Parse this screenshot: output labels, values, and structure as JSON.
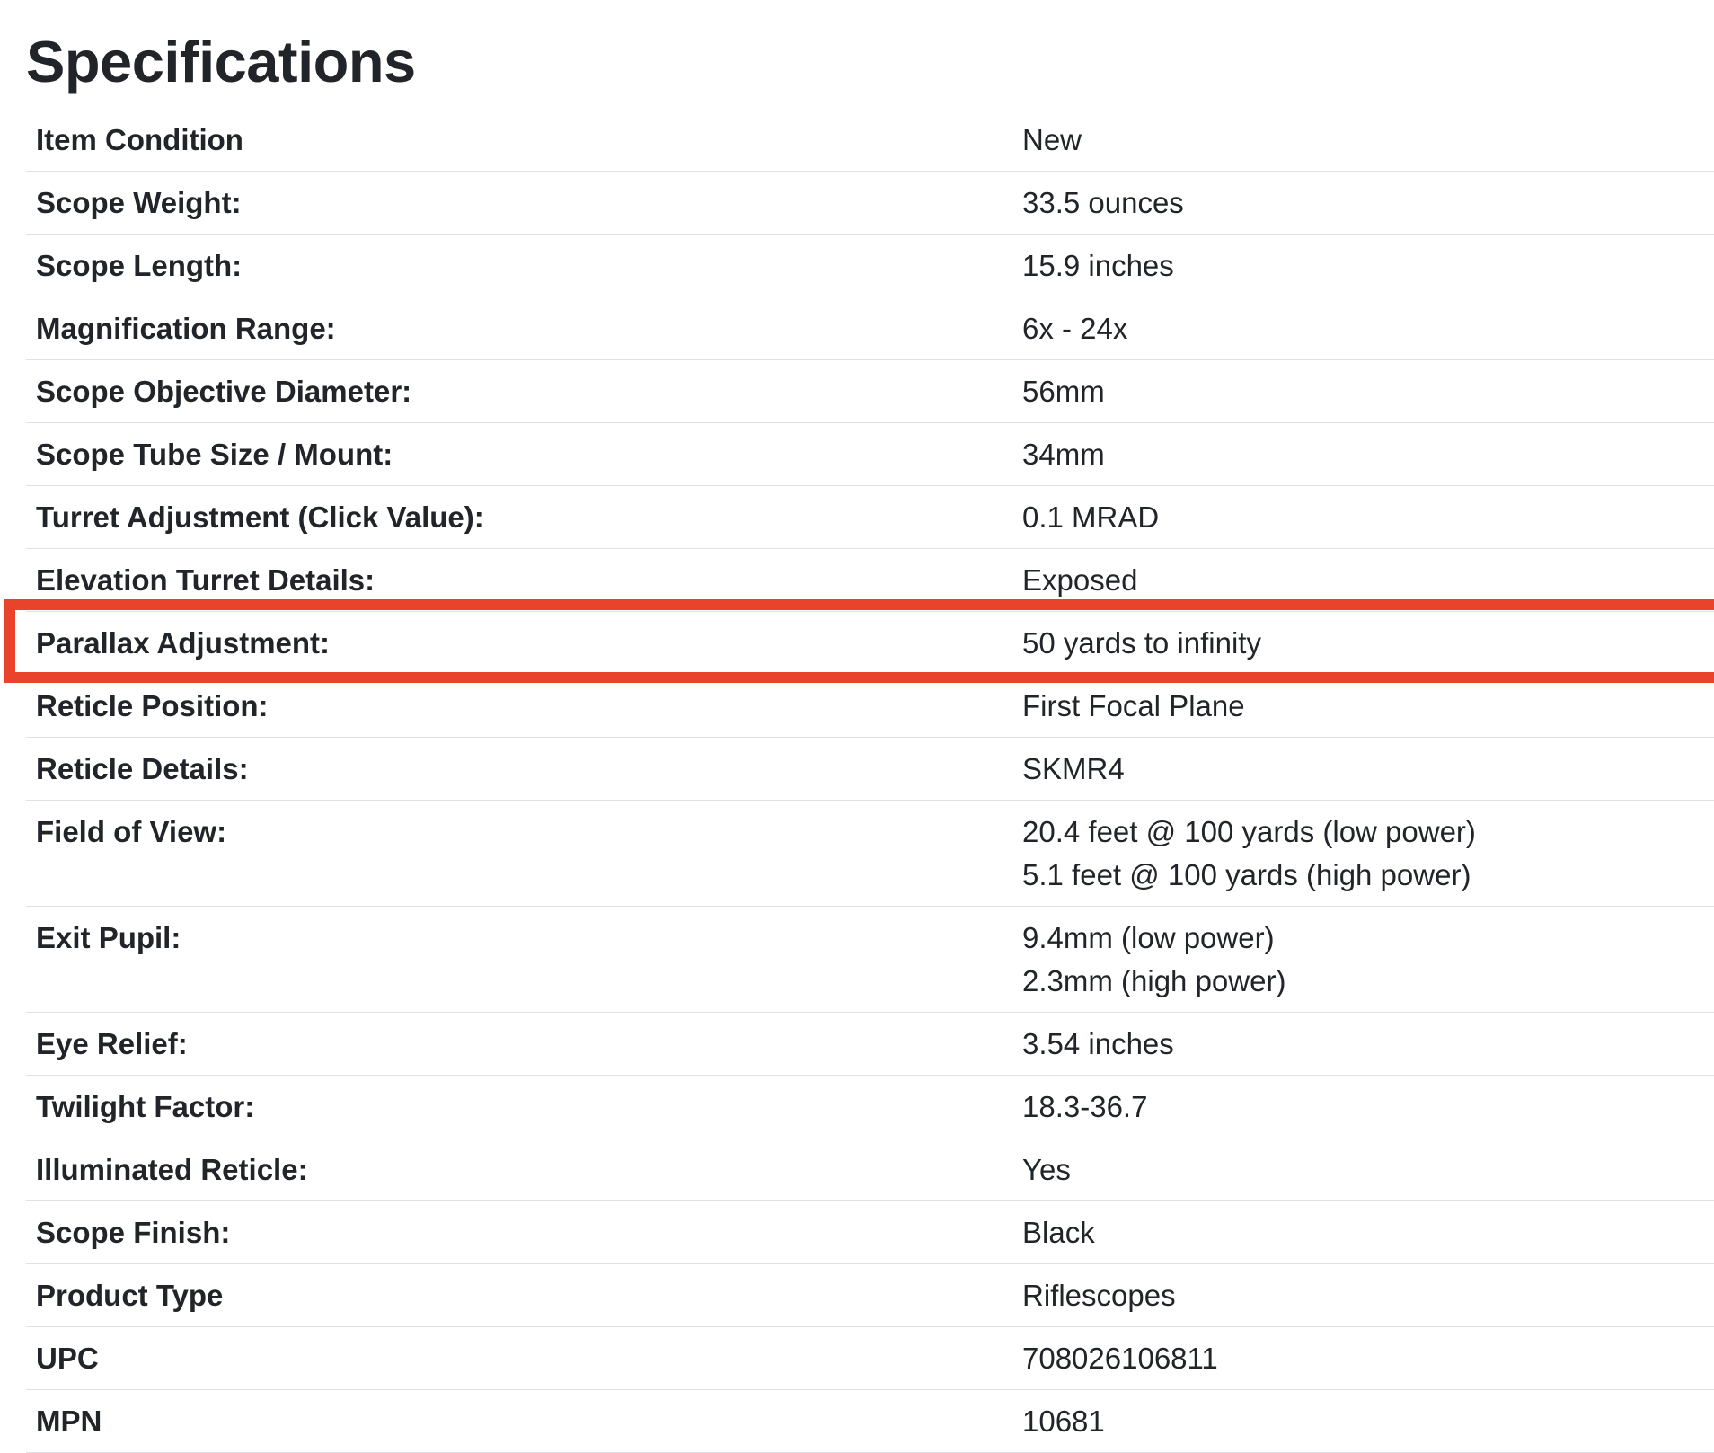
{
  "title": "Specifications",
  "highlight_color": "#e9432b",
  "highlighted_row": "Parallax Adjustment:",
  "rows": [
    {
      "label": "Item Condition",
      "values": [
        "New"
      ]
    },
    {
      "label": "Scope Weight:",
      "values": [
        "33.5 ounces"
      ]
    },
    {
      "label": "Scope Length:",
      "values": [
        "15.9 inches"
      ]
    },
    {
      "label": "Magnification Range:",
      "values": [
        "6x - 24x"
      ]
    },
    {
      "label": "Scope Objective Diameter:",
      "values": [
        "56mm"
      ]
    },
    {
      "label": "Scope Tube Size / Mount:",
      "values": [
        "34mm"
      ]
    },
    {
      "label": "Turret Adjustment (Click Value):",
      "values": [
        "0.1 MRAD"
      ]
    },
    {
      "label": "Elevation Turret Details:",
      "values": [
        "Exposed"
      ]
    },
    {
      "label": "Parallax Adjustment:",
      "values": [
        "50 yards to infinity"
      ]
    },
    {
      "label": "Reticle Position:",
      "values": [
        "First Focal Plane"
      ]
    },
    {
      "label": "Reticle Details:",
      "values": [
        "SKMR4"
      ]
    },
    {
      "label": "Field of View:",
      "values": [
        "20.4 feet @ 100 yards (low power)",
        "5.1 feet @ 100 yards (high power)"
      ]
    },
    {
      "label": "Exit Pupil:",
      "values": [
        "9.4mm (low power)",
        "2.3mm (high power)"
      ]
    },
    {
      "label": "Eye Relief:",
      "values": [
        "3.54 inches"
      ]
    },
    {
      "label": "Twilight Factor:",
      "values": [
        "18.3-36.7"
      ]
    },
    {
      "label": "Illuminated Reticle:",
      "values": [
        "Yes"
      ]
    },
    {
      "label": "Scope Finish:",
      "values": [
        "Black"
      ]
    },
    {
      "label": "Product Type",
      "values": [
        "Riflescopes"
      ]
    },
    {
      "label": "UPC",
      "values": [
        "708026106811"
      ]
    },
    {
      "label": "MPN",
      "values": [
        "10681"
      ]
    }
  ]
}
